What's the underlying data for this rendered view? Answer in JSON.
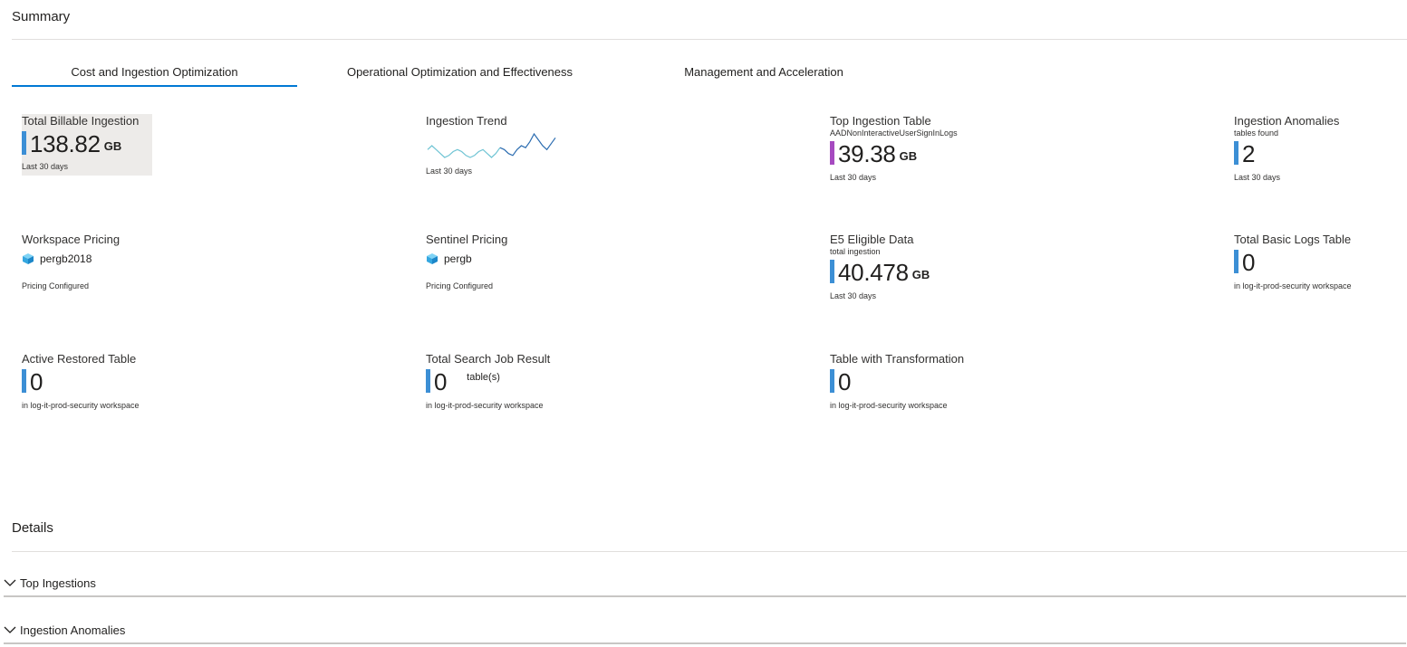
{
  "summary": {
    "title": "Summary"
  },
  "tabs": [
    {
      "label": "Cost and Ingestion Optimization",
      "active": true
    },
    {
      "label": "Operational Optimization and Effectiveness",
      "active": false
    },
    {
      "label": "Management and Acceleration",
      "active": false
    }
  ],
  "tiles": {
    "total_billable": {
      "title": "Total Billable Ingestion",
      "value": "138.82",
      "unit": "GB",
      "footer": "Last 30 days"
    },
    "ingestion_trend": {
      "title": "Ingestion Trend",
      "footer": "Last 30 days",
      "sparkline": [
        5,
        6,
        5,
        4,
        3,
        3.5,
        4.5,
        5,
        4.5,
        3.5,
        3,
        3.5,
        4.5,
        5,
        4,
        3,
        4,
        5.5,
        5,
        4,
        3.5,
        5,
        6,
        5.5,
        7,
        9,
        7.5,
        6,
        5,
        6.5,
        8
      ]
    },
    "top_table": {
      "title": "Top Ingestion Table",
      "subtitle": "AADNonInteractiveUserSignInLogs",
      "value": "39.38",
      "unit": "GB",
      "footer": "Last 30 days"
    },
    "anomalies": {
      "title": "Ingestion Anomalies",
      "subtitle": "tables found",
      "value": "2",
      "footer": "Last 30 days"
    },
    "workspace_pricing": {
      "title": "Workspace Pricing",
      "value": "pergb2018",
      "footer": "Pricing Configured"
    },
    "sentinel_pricing": {
      "title": "Sentinel Pricing",
      "value": "pergb",
      "footer": "Pricing Configured"
    },
    "e5_data": {
      "title": "E5 Eligible Data",
      "subtitle": "total ingestion",
      "value": "40.478",
      "unit": "GB",
      "footer": "Last 30 days"
    },
    "basic_logs": {
      "title": "Total Basic Logs Table",
      "value": "0",
      "footer": "in log-it-prod-security workspace"
    },
    "restored": {
      "title": "Active Restored Table",
      "value": "0",
      "footer": "in log-it-prod-security workspace"
    },
    "search_job": {
      "title": "Total Search Job Result",
      "value": "0",
      "unit": "table(s)",
      "footer": "in log-it-prod-security workspace"
    },
    "transformation": {
      "title": "Table with Transformation",
      "value": "0",
      "footer": "in log-it-prod-security workspace"
    }
  },
  "details": {
    "title": "Details",
    "rows": [
      {
        "label": "Top Ingestions"
      },
      {
        "label": "Ingestion Anomalies"
      }
    ]
  },
  "colors": {
    "accent": "#0078d4",
    "bar_blue": "#3c8fd5",
    "bar_purple": "#a64ac0",
    "highlight_bg": "#edebe9"
  }
}
